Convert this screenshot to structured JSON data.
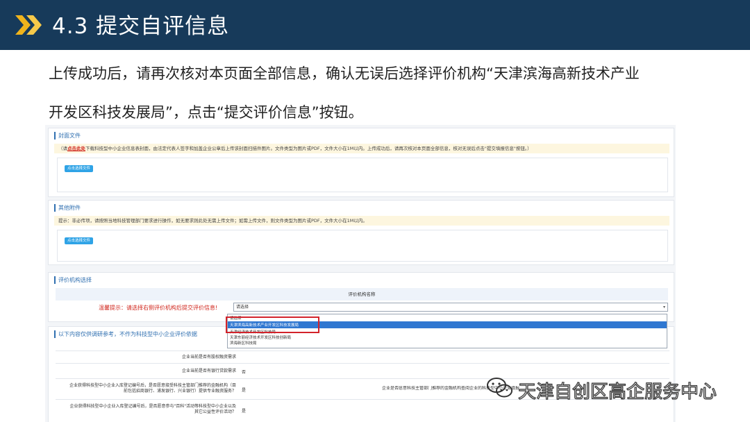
{
  "banner": {
    "title": "4.3 提交自评信息"
  },
  "intro": {
    "line1": "上传成功后，请再次核对本页面全部信息，确认无误后选择评价机构“天津滨海高新技术产业",
    "line2": "开发区科技发展局”，点击“提交评价信息”按钮。"
  },
  "cover_section": {
    "title": "封面文件",
    "note_prefix": "（请",
    "note_link": "点击此处",
    "note_rest": "下载科技型中小企业信息表封面，由法定代表人签字和加盖企业公章后上传该封面扫描件图片。文件类型为图片或PDF，文件大小在1M以内。上传成功后，请再次核对本页面全部信息，核对无误后点击\"提交填报信息\"按钮。）",
    "upload_button": "点击选择文件"
  },
  "other_section": {
    "title": "其他附件",
    "note": "提示：非必传项，请按照当地科技管理部门要求进行操作，如无要求则此处无需上传文件；如需上传文件，则文件类型为图片或PDF，文件大小在1M以内。",
    "upload_button": "点击选择文件"
  },
  "org_section": {
    "title": "评价机构选择",
    "column_header": "评价机构名称",
    "tip": "温馨提示：请选择右侧评价机构后提交评价信息!",
    "select_value": "请选择",
    "options": [
      "请选择",
      "天津滨海高新技术产业开发区科技发展局",
      "天津经济技术开发区科技局",
      "天津东丽经济技术开发区科技创新局",
      "滨海新区科技局"
    ],
    "selected_index": 1
  },
  "reference_section": {
    "title": "以下内容仅供调研参考，不作为科技型中小企业评价依据",
    "rows": [
      {
        "label": "企业当前是否有股权融资需求",
        "value": ""
      },
      {
        "label": "企业当前是否有银行贷款需求",
        "value": "否"
      },
      {
        "label": "企业获得科技型中小企业入库登记编号后，是否愿意接受科技主管部门推荐的金融机构（目前包括招商银行、浦发银行、兴业银行）提供专业融资服务？",
        "value": "是",
        "right_label": "企业是否愿意科技主管部门推荐的金融机构查阅企业的科技型中小企业填报",
        "right_value": ""
      },
      {
        "label": "企业获得科技型中小企业入库登记编号后，是否愿意参与\"百科\"活动等科技型中小企业以及其它公益性评价活动？",
        "value": "是"
      }
    ]
  },
  "watermark": {
    "text": "天津自创区高企服务中心"
  }
}
